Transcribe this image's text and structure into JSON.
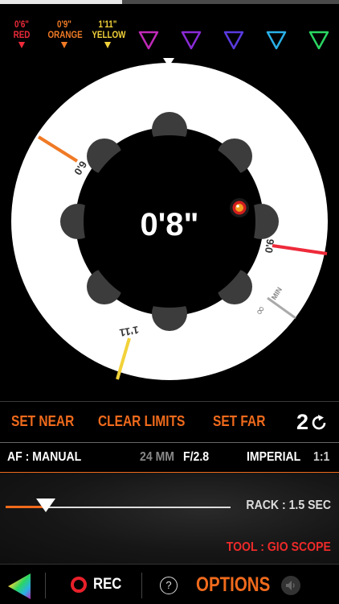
{
  "progress": {
    "fraction": 0.36
  },
  "marks": [
    {
      "value": "0'6\"",
      "label": "RED",
      "color": "#ee2a3a"
    },
    {
      "value": "0'9\"",
      "label": "ORANGE",
      "color": "#f07a26"
    },
    {
      "value": "1'11\"",
      "label": "YELLOW",
      "color": "#f2d23a"
    }
  ],
  "empty_slots": [
    {
      "color": "#c02ab8",
      "icon": "triangle-down-icon"
    },
    {
      "color": "#8a2ad6",
      "icon": "triangle-down-icon"
    },
    {
      "color": "#5a3ae0",
      "icon": "triangle-down-icon"
    },
    {
      "color": "#2ab0e6",
      "icon": "triangle-down-icon"
    },
    {
      "color": "#2ad662",
      "icon": "triangle-down-icon"
    }
  ],
  "dial": {
    "current_distance": "0'8\"",
    "ring_labels": {
      "near": "0'6",
      "far": "0'9",
      "yellow": "1'11",
      "min": "MIN",
      "infinity": "∞"
    }
  },
  "buttons": {
    "set_near": "SET NEAR",
    "clear_limits": "CLEAR LIMITS",
    "set_far": "SET FAR",
    "counter": "2"
  },
  "info": {
    "af": "AF : MANUAL",
    "focal_length": "24 MM",
    "aperture": "F/2.8",
    "units": "IMPERIAL",
    "ratio": "1:1"
  },
  "rack": {
    "label": "RACK : 1.5 SEC",
    "slider_position": 0.18
  },
  "tool": {
    "label": "TOOL : GIO SCOPE"
  },
  "bottom": {
    "rec": "REC",
    "help": "?",
    "options": "OPTIONS"
  },
  "colors": {
    "accent": "#f06a1c",
    "record": "#e8202a",
    "tool": "#ee2a2a"
  }
}
